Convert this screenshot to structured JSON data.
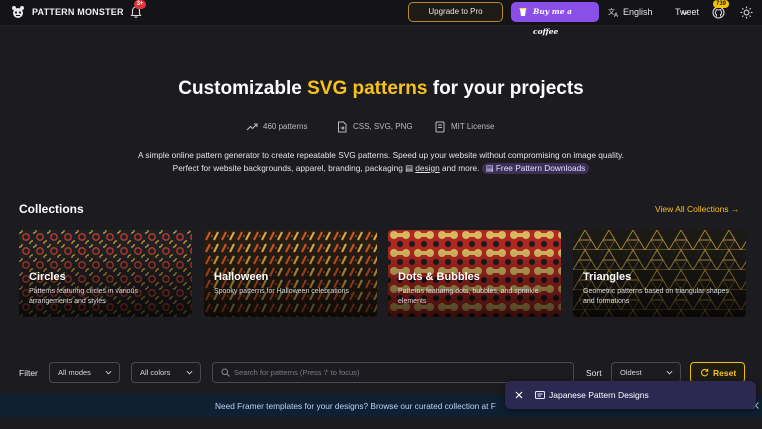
{
  "header": {
    "brand": "PATTERN MONSTER",
    "notification_count": "3+",
    "upgrade_label": "Upgrade to Pro",
    "coffee_label": "Buy me a coffee",
    "language": "English",
    "tweet_label": "Tweet",
    "github_stars": "739"
  },
  "hero": {
    "title_part1": "Customizable ",
    "title_accent": "SVG patterns",
    "title_part2": " for your projects",
    "accent_color": "#f7c21a",
    "stats": [
      {
        "icon": "trending-up-icon",
        "text": "460 patterns"
      },
      {
        "icon": "file-export-icon",
        "text": "CSS, SVG, PNG"
      },
      {
        "icon": "license-icon",
        "text": "MIT License"
      }
    ],
    "description_part1": "A simple online pattern generator to create repeatable SVG patterns. Speed up your website without compromising on image quality. Perfect for website backgrounds, apparel, branding, packaging ",
    "description_link": "design",
    "description_part2": " and more. ",
    "downloads_label": "Free Pattern Downloads"
  },
  "collections": {
    "title": "Collections",
    "view_all": "View All Collections →",
    "items": [
      {
        "title": "Circles",
        "description": "Patterns featuring circles in various arrangements and styles"
      },
      {
        "title": "Halloween",
        "description": "Spooky patterns for Halloween celebrations"
      },
      {
        "title": "Dots & Bubbles",
        "description": "Patterns featuring dots, bubbles, and sprinkle elements"
      },
      {
        "title": "Triangles",
        "description": "Geometric patterns based on triangular shapes and formations"
      }
    ]
  },
  "filters": {
    "label": "Filter",
    "mode_value": "All modes",
    "color_value": "All colors",
    "search_placeholder": "Search for patterns (Press '/' to focus)",
    "sort_label": "Sort",
    "sort_value": "Oldest",
    "reset_label": "Reset"
  },
  "banner": {
    "text": "Need Framer templates for your designs? Browse our curated collection at F"
  },
  "toast": {
    "label": "Japanese Pattern Designs"
  }
}
